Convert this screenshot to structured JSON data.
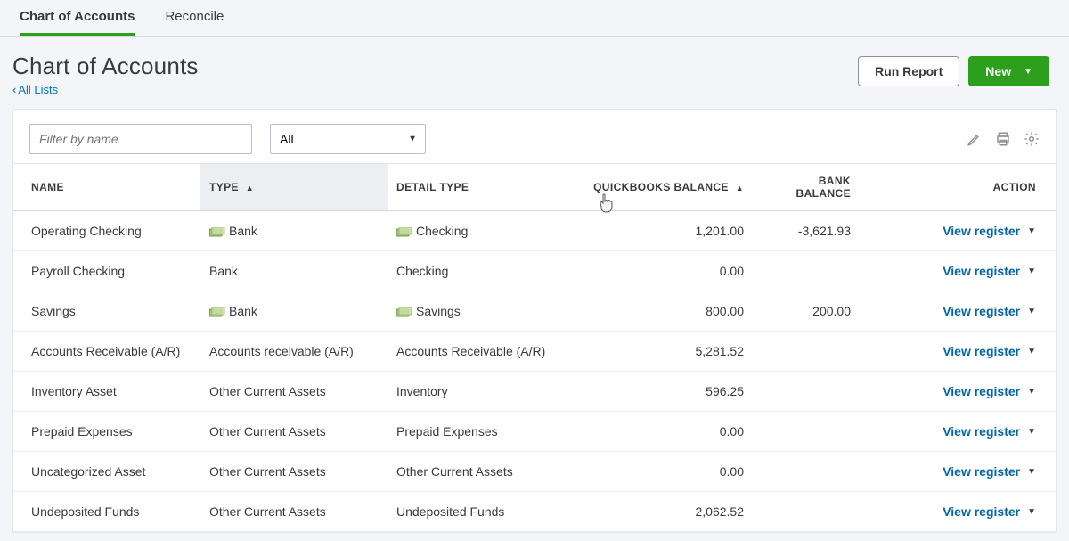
{
  "tabs": {
    "chart": "Chart of Accounts",
    "reconcile": "Reconcile"
  },
  "page": {
    "title": "Chart of Accounts",
    "back_label": "All Lists"
  },
  "header_buttons": {
    "run_report": "Run Report",
    "new": "New"
  },
  "toolbar": {
    "filter_placeholder": "Filter by name",
    "type_filter_value": "All"
  },
  "columns": {
    "name": "NAME",
    "type": "TYPE",
    "detail": "DETAIL TYPE",
    "qb_balance": "QUICKBOOKS BALANCE",
    "bank_balance": "BANK BALANCE",
    "action": "ACTION"
  },
  "action_label": "View register",
  "rows": [
    {
      "name": "Operating Checking",
      "type": "Bank",
      "type_icon": true,
      "detail": "Checking",
      "detail_icon": true,
      "qb": "1,201.00",
      "bank": "-3,621.93",
      "action": "View register"
    },
    {
      "name": "Payroll Checking",
      "type": "Bank",
      "type_icon": false,
      "detail": "Checking",
      "detail_icon": false,
      "qb": "0.00",
      "bank": "",
      "action": "View register"
    },
    {
      "name": "Savings",
      "type": "Bank",
      "type_icon": true,
      "detail": "Savings",
      "detail_icon": true,
      "qb": "800.00",
      "bank": "200.00",
      "action": "View register"
    },
    {
      "name": "Accounts Receivable (A/R)",
      "type": "Accounts receivable (A/R)",
      "type_icon": false,
      "detail": "Accounts Receivable (A/R)",
      "detail_icon": false,
      "qb": "5,281.52",
      "bank": "",
      "action": "View register"
    },
    {
      "name": "Inventory Asset",
      "type": "Other Current Assets",
      "type_icon": false,
      "detail": "Inventory",
      "detail_icon": false,
      "qb": "596.25",
      "bank": "",
      "action": "View register"
    },
    {
      "name": "Prepaid Expenses",
      "type": "Other Current Assets",
      "type_icon": false,
      "detail": "Prepaid Expenses",
      "detail_icon": false,
      "qb": "0.00",
      "bank": "",
      "action": "View register"
    },
    {
      "name": "Uncategorized Asset",
      "type": "Other Current Assets",
      "type_icon": false,
      "detail": "Other Current Assets",
      "detail_icon": false,
      "qb": "0.00",
      "bank": "",
      "action": "View register"
    },
    {
      "name": "Undeposited Funds",
      "type": "Other Current Assets",
      "type_icon": false,
      "detail": "Undeposited Funds",
      "detail_icon": false,
      "qb": "2,062.52",
      "bank": "",
      "action": "View register"
    }
  ]
}
